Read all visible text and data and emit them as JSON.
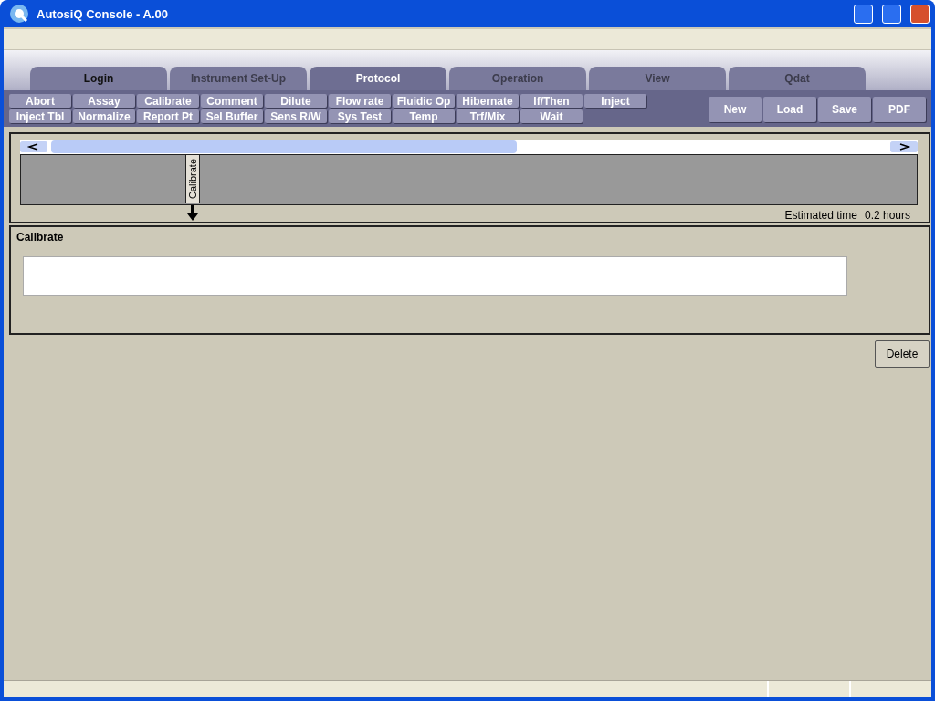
{
  "window": {
    "title": "AutosiQ Console - A.00"
  },
  "tabs": [
    {
      "label": "Login",
      "selected": false,
      "disabled": false
    },
    {
      "label": "Instrument Set-Up",
      "selected": false,
      "disabled": true
    },
    {
      "label": "Protocol",
      "selected": true,
      "disabled": false
    },
    {
      "label": "Operation",
      "selected": false,
      "disabled": true
    },
    {
      "label": "View",
      "selected": false,
      "disabled": true
    },
    {
      "label": "Qdat",
      "selected": false,
      "disabled": true
    }
  ],
  "step_buttons": [
    "Abort",
    "Assay",
    "Calibrate",
    "Comment",
    "Dilute",
    "Flow rate",
    "Fluidic Op",
    "Hibernate",
    "If/Then",
    "Inject",
    "Inject Tbl",
    "Normalize",
    "Report Pt",
    "Sel Buffer",
    "Sens R/W",
    "Sys Test",
    "Temp",
    "Trf/Mix",
    "Wait"
  ],
  "file_buttons": [
    "New",
    "Load",
    "Save",
    "PDF"
  ],
  "timeline": {
    "steps": [
      {
        "label": "Calibrate",
        "selected": true
      }
    ],
    "estimate_label": "Estimated time",
    "estimate_value": "0.2 hours"
  },
  "step_panel": {
    "title": "Calibrate"
  },
  "delete_button": "Delete"
}
